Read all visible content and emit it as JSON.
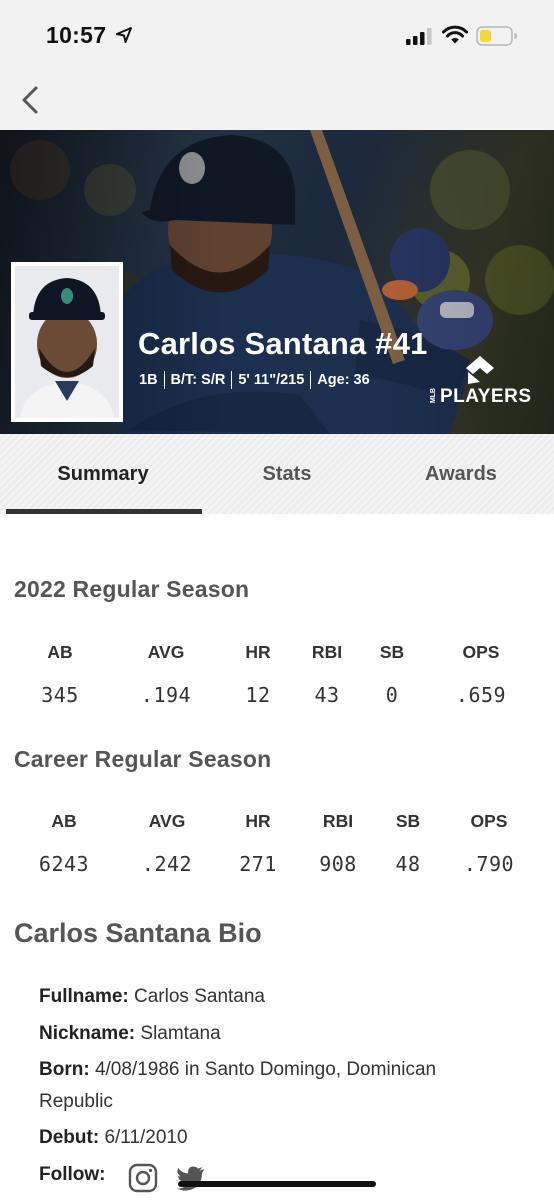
{
  "status_bar": {
    "time": "10:57"
  },
  "player": {
    "name_number": "Carlos Santana #41",
    "position": "1B",
    "bats_throws": "B/T: S/R",
    "height_weight": "5' 11\"/215",
    "age": "Age: 36",
    "players_logo_text": "PLAYERS",
    "players_logo_small": "MLB"
  },
  "tabs": [
    {
      "label": "Summary",
      "active": true
    },
    {
      "label": "Stats",
      "active": false
    },
    {
      "label": "Awards",
      "active": false
    }
  ],
  "season_2022": {
    "title": "2022 Regular Season",
    "headers": [
      "AB",
      "AVG",
      "HR",
      "RBI",
      "SB",
      "OPS"
    ],
    "values": [
      "345",
      ".194",
      "12",
      "43",
      "0",
      ".659"
    ]
  },
  "career": {
    "title": "Career Regular Season",
    "headers": [
      "AB",
      "AVG",
      "HR",
      "RBI",
      "SB",
      "OPS"
    ],
    "values": [
      "6243",
      ".242",
      "271",
      "908",
      "48",
      ".790"
    ]
  },
  "bio": {
    "title": "Carlos Santana Bio",
    "fullname_label": "Fullname:",
    "fullname": "Carlos Santana",
    "nickname_label": "Nickname:",
    "nickname": "Slamtana",
    "born_label": "Born:",
    "born": "4/08/1986 in Santo Domingo, Dominican Republic",
    "debut_label": "Debut:",
    "debut": "6/11/2010",
    "follow_label": "Follow:"
  },
  "icons": [
    "location-arrow-icon",
    "cellular-signal-icon",
    "wifi-icon",
    "battery-icon",
    "back-chevron-icon",
    "instagram-icon",
    "twitter-icon"
  ],
  "colors": {
    "battery_fill": "#f5d63d",
    "hero_jersey": "#1f3457",
    "text_dark": "#333333"
  }
}
